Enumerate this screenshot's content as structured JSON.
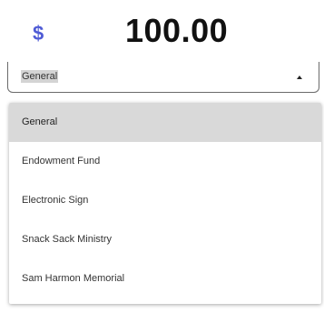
{
  "amount": {
    "currency_symbol": "$",
    "value": "100.00"
  },
  "fund_select": {
    "selected": "General",
    "icon": "caret-up-icon"
  },
  "dropdown": {
    "options": [
      "General",
      "Endowment Fund",
      "Electronic Sign",
      "Snack Sack Ministry",
      "Sam Harmon Memorial"
    ],
    "selected_index": 0
  },
  "colors": {
    "accent": "#4f5bd5",
    "selected_bg": "#d9d9d9"
  }
}
